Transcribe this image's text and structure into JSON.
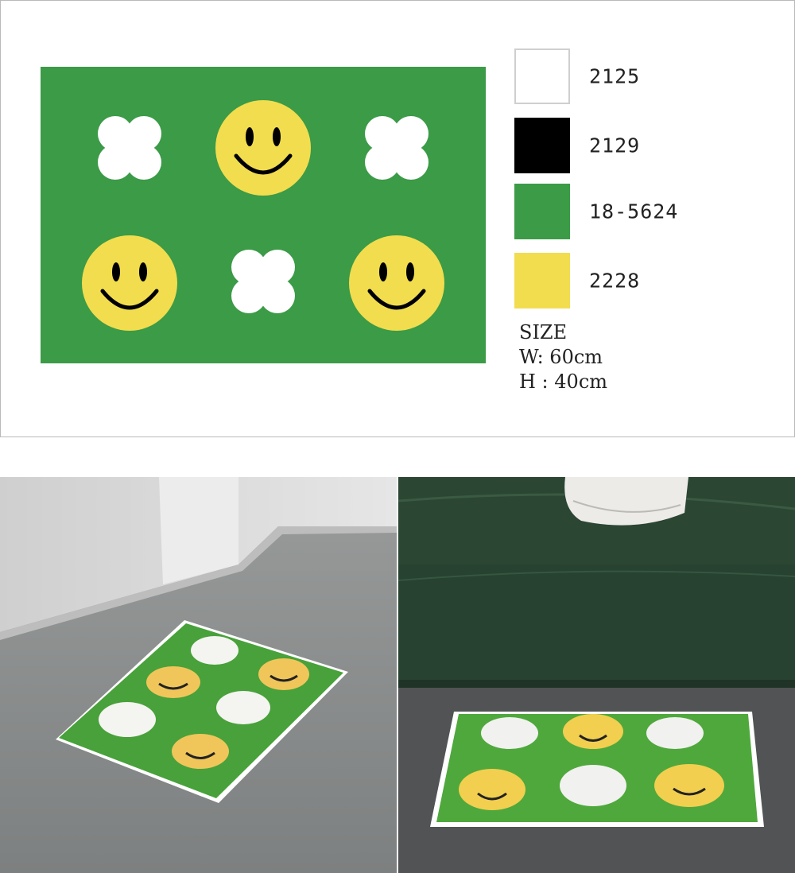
{
  "design": {
    "background_color": "#3b9b47",
    "motif_rows": [
      [
        "clover-icon",
        "smiley-icon",
        "clover-icon"
      ],
      [
        "smiley-icon",
        "clover-icon",
        "smiley-icon"
      ]
    ]
  },
  "palette": [
    {
      "code": "2125",
      "color": "#ffffff"
    },
    {
      "code": "2129",
      "color": "#000000"
    },
    {
      "code": "18-5624",
      "color": "#3b9b47"
    },
    {
      "code": "2228",
      "color": "#f2dd4e"
    }
  ],
  "size": {
    "heading": "SIZE",
    "width": "W: 60cm",
    "height": "H : 40cm"
  },
  "photos": [
    {
      "scene": "rug on grey concrete floor",
      "floor_color": "#8e9090"
    },
    {
      "scene": "rug in front of green velvet sofa",
      "sofa_color": "#26402e"
    }
  ]
}
